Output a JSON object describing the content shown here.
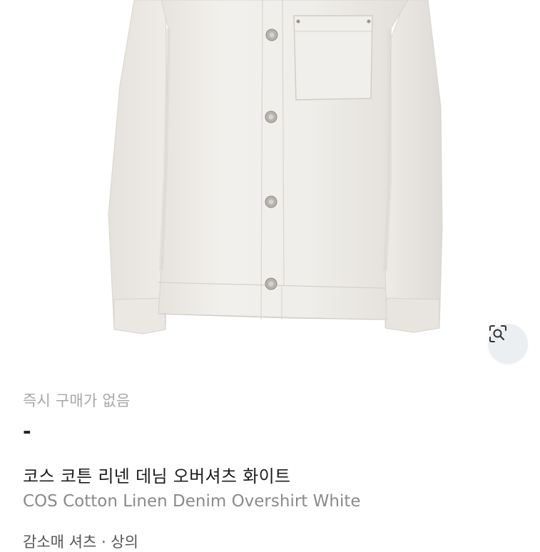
{
  "product": {
    "status": "즉시 구매가 없음",
    "price": "-",
    "title_ko": "코스 코튼 리넨 데님 오버셔츠 화이트",
    "title_en": "COS Cotton Linen Denim Overshirt White",
    "extra_line": "감소매 셔츠 · 상의"
  },
  "image": {
    "subject": "white overshirt",
    "background_color": "#ffffff",
    "garment_color": "#efedea"
  },
  "icons": {
    "lens": "image-search-icon"
  }
}
